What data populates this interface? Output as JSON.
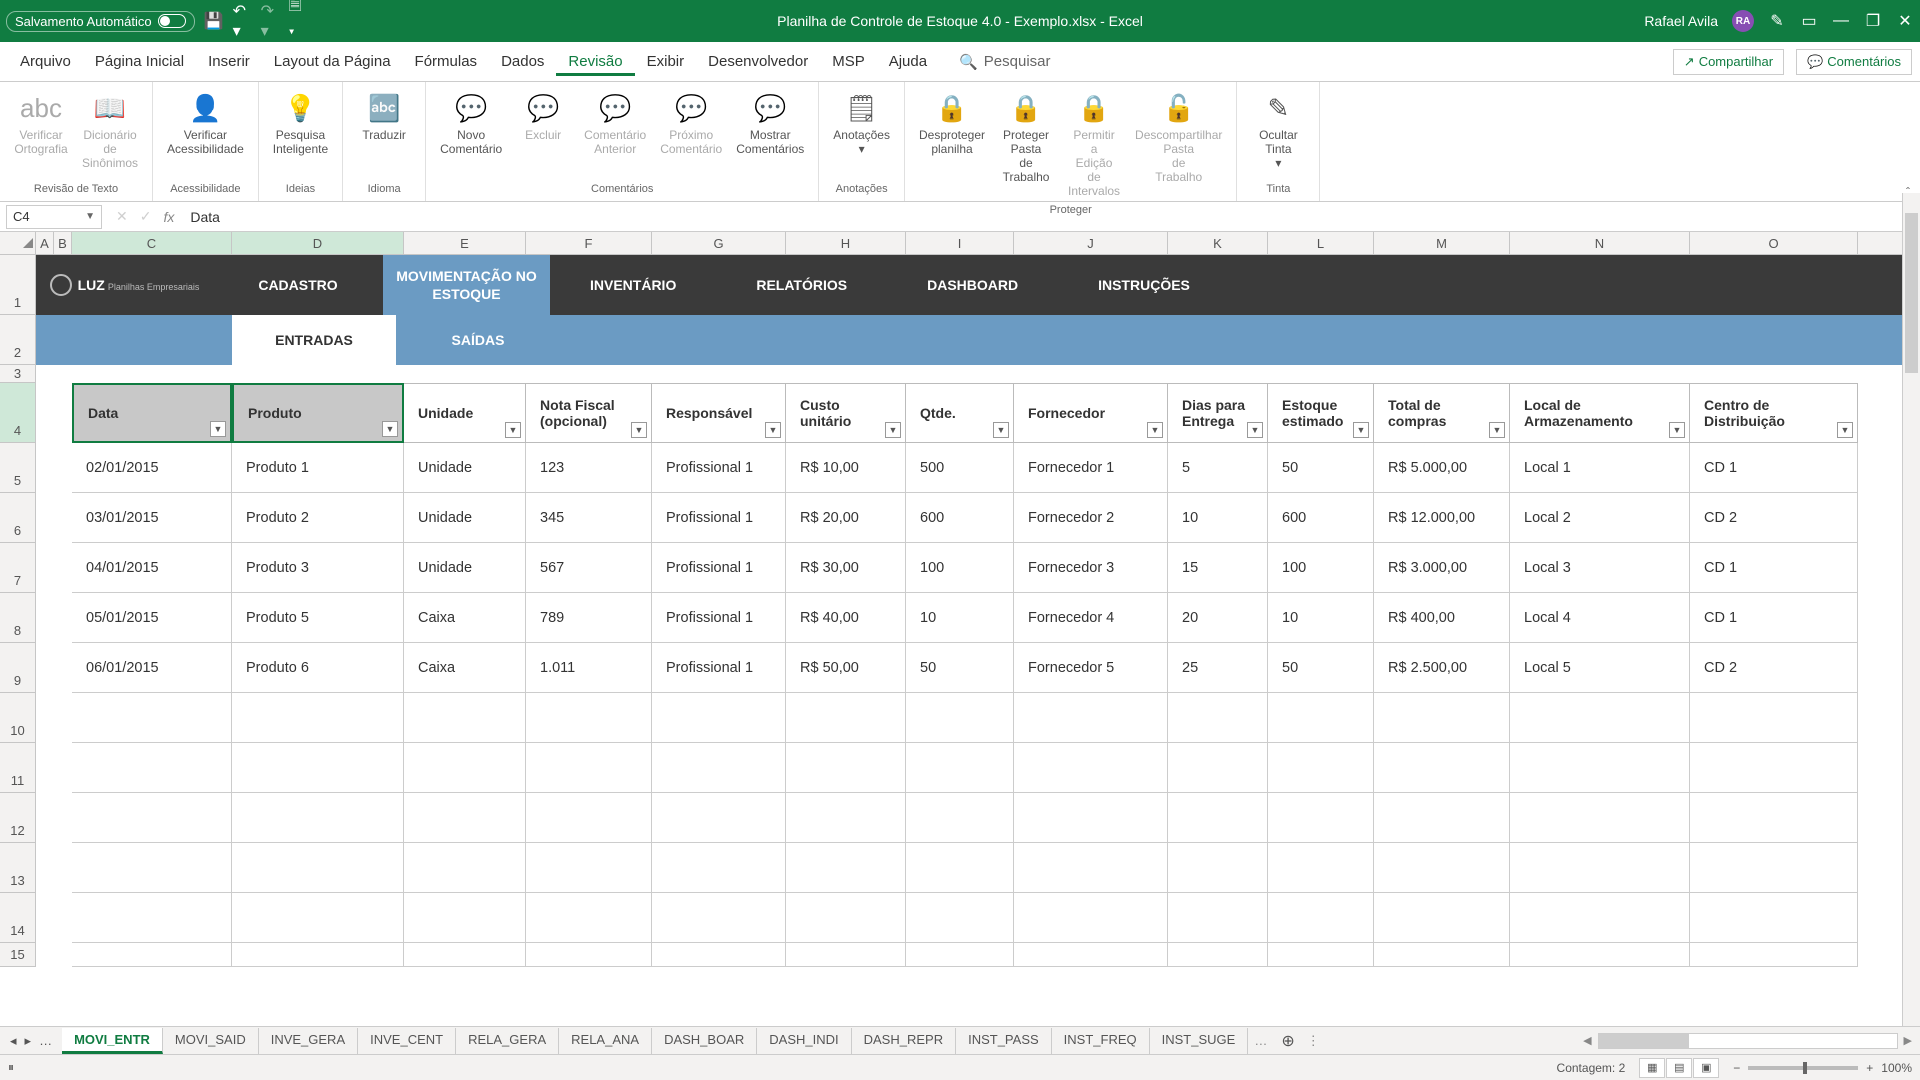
{
  "titlebar": {
    "autosave": "Salvamento Automático",
    "doc_title": "Planilha de Controle de Estoque 4.0 - Exemplo.xlsx  -  Excel",
    "user": "Rafael Avila",
    "initials": "RA"
  },
  "menu": [
    "Arquivo",
    "Página Inicial",
    "Inserir",
    "Layout da Página",
    "Fórmulas",
    "Dados",
    "Revisão",
    "Exibir",
    "Desenvolvedor",
    "MSP",
    "Ajuda"
  ],
  "menu_active": "Revisão",
  "search_placeholder": "Pesquisar",
  "share": "Compartilhar",
  "comments": "Comentários",
  "ribbon": {
    "groups": [
      {
        "label": "Revisão de Texto",
        "btns": [
          {
            "t": "Verificar Ortografia",
            "d": true,
            "ico": "abc"
          },
          {
            "t": "Dicionário de Sinônimos",
            "d": true,
            "ico": "📖"
          }
        ]
      },
      {
        "label": "Acessibilidade",
        "btns": [
          {
            "t": "Verificar Acessibilidade",
            "d": false,
            "ico": "👤"
          }
        ]
      },
      {
        "label": "Ideias",
        "btns": [
          {
            "t": "Pesquisa Inteligente",
            "d": false,
            "ico": "💡"
          }
        ]
      },
      {
        "label": "Idioma",
        "btns": [
          {
            "t": "Traduzir",
            "d": false,
            "ico": "🔤"
          }
        ]
      },
      {
        "label": "Comentários",
        "btns": [
          {
            "t": "Novo Comentário",
            "d": false,
            "ico": "💬"
          },
          {
            "t": "Excluir",
            "d": true,
            "ico": "💬"
          },
          {
            "t": "Comentário Anterior",
            "d": true,
            "ico": "💬"
          },
          {
            "t": "Próximo Comentário",
            "d": true,
            "ico": "💬"
          },
          {
            "t": "Mostrar Comentários",
            "d": false,
            "ico": "💬"
          }
        ]
      },
      {
        "label": "Anotações",
        "btns": [
          {
            "t": "Anotações ▾",
            "d": false,
            "ico": "🗒"
          }
        ]
      },
      {
        "label": "Proteger",
        "btns": [
          {
            "t": "Desproteger planilha",
            "d": false,
            "ico": "🔒"
          },
          {
            "t": "Proteger Pasta de Trabalho",
            "d": false,
            "ico": "🔒"
          },
          {
            "t": "Permitir a Edição de Intervalos",
            "d": true,
            "ico": "🔒"
          },
          {
            "t": "Descompartilhar Pasta de Trabalho",
            "d": true,
            "ico": "🔓"
          }
        ]
      },
      {
        "label": "Tinta",
        "btns": [
          {
            "t": "Ocultar Tinta ▾",
            "d": false,
            "ico": "✎"
          }
        ]
      }
    ]
  },
  "namebox": "C4",
  "formula": "Data",
  "columns": [
    "A",
    "B",
    "C",
    "D",
    "E",
    "F",
    "G",
    "H",
    "I",
    "J",
    "K",
    "L",
    "M",
    "N",
    "O"
  ],
  "logo_sub": "Planilhas Empresariais",
  "nav_tabs": {
    "cadastro": "CADASTRO",
    "mov": "MOVIMENTAÇÃO NO ESTOQUE",
    "inv": "INVENTÁRIO",
    "rel": "RELATÓRIOS",
    "dash": "DASHBOARD",
    "inst": "INSTRUÇÕES"
  },
  "sub_tabs": {
    "entradas": "ENTRADAS",
    "saidas": "SAÍDAS"
  },
  "headers": [
    "Data",
    "Produto",
    "Unidade",
    "Nota Fiscal (opcional)",
    "Responsável",
    "Custo unitário",
    "Qtde.",
    "Fornecedor",
    "Dias para Entrega",
    "Estoque estimado",
    "Total de compras",
    "Local de Armazenamento",
    "Centro de Distribuição"
  ],
  "rows": [
    [
      "02/01/2015",
      "Produto 1",
      "Unidade",
      "123",
      "Profissional 1",
      "R$ 10,00",
      "500",
      "Fornecedor 1",
      "5",
      "50",
      "R$ 5.000,00",
      "Local 1",
      "CD 1"
    ],
    [
      "03/01/2015",
      "Produto 2",
      "Unidade",
      "345",
      "Profissional 1",
      "R$ 20,00",
      "600",
      "Fornecedor 2",
      "10",
      "600",
      "R$ 12.000,00",
      "Local 2",
      "CD 2"
    ],
    [
      "04/01/2015",
      "Produto 3",
      "Unidade",
      "567",
      "Profissional 1",
      "R$ 30,00",
      "100",
      "Fornecedor 3",
      "15",
      "100",
      "R$ 3.000,00",
      "Local 3",
      "CD 1"
    ],
    [
      "05/01/2015",
      "Produto 5",
      "Caixa",
      "789",
      "Profissional 1",
      "R$ 40,00",
      "10",
      "Fornecedor 4",
      "20",
      "10",
      "R$ 400,00",
      "Local 4",
      "CD 1"
    ],
    [
      "06/01/2015",
      "Produto 6",
      "Caixa",
      "1.011",
      "Profissional 1",
      "R$ 50,00",
      "50",
      "Fornecedor 5",
      "25",
      "50",
      "R$ 2.500,00",
      "Local 5",
      "CD 2"
    ]
  ],
  "sheets": [
    "MOVI_ENTR",
    "MOVI_SAID",
    "INVE_GERA",
    "INVE_CENT",
    "RELA_GERA",
    "RELA_ANA",
    "DASH_BOAR",
    "DASH_INDI",
    "DASH_REPR",
    "INST_PASS",
    "INST_FREQ",
    "INST_SUGE"
  ],
  "sheet_active": "MOVI_ENTR",
  "status": {
    "ready_ico": "⏸",
    "contagem": "Contagem: 2",
    "zoom": "100%"
  }
}
